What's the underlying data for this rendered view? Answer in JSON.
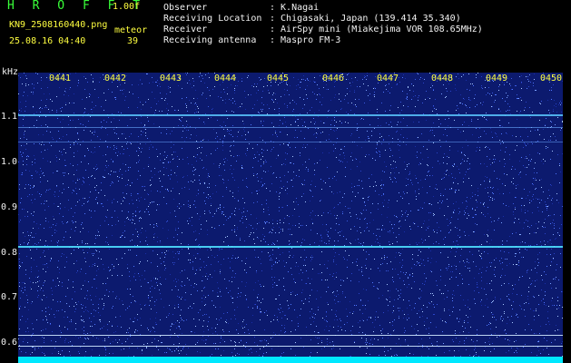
{
  "header": {
    "logo": "H R O F F T",
    "version": "1.00f",
    "filename": "KN9_2508160440.png",
    "meteor_label": "meteor",
    "datetime": "25.08.16 04:40",
    "meteor_count": "39"
  },
  "info": [
    {
      "key": "Observer",
      "value": ": K.Nagai"
    },
    {
      "key": "Receiving Location",
      "value": ": Chigasaki, Japan (139.414 35.340)"
    },
    {
      "key": "Receiver",
      "value": ": AirSpy mini (Miakejima VOR 108.65MHz)"
    },
    {
      "key": "Receiving antenna",
      "value": ": Maspro FM-3"
    }
  ],
  "axis": {
    "unit": "kHz",
    "y_ticks": [
      "1.1",
      "1.0",
      "0.9",
      "0.8",
      "0.7",
      "0.6"
    ],
    "x_ticks": [
      "0441",
      "0442",
      "0443",
      "0444",
      "0445",
      "0446",
      "0447",
      "0448",
      "0449",
      "0450"
    ]
  },
  "colors": {
    "background": "#0c1a6e",
    "signal": "#4fe0ff",
    "label_yellow": "#ffff40",
    "label_green": "#39ff39"
  }
}
